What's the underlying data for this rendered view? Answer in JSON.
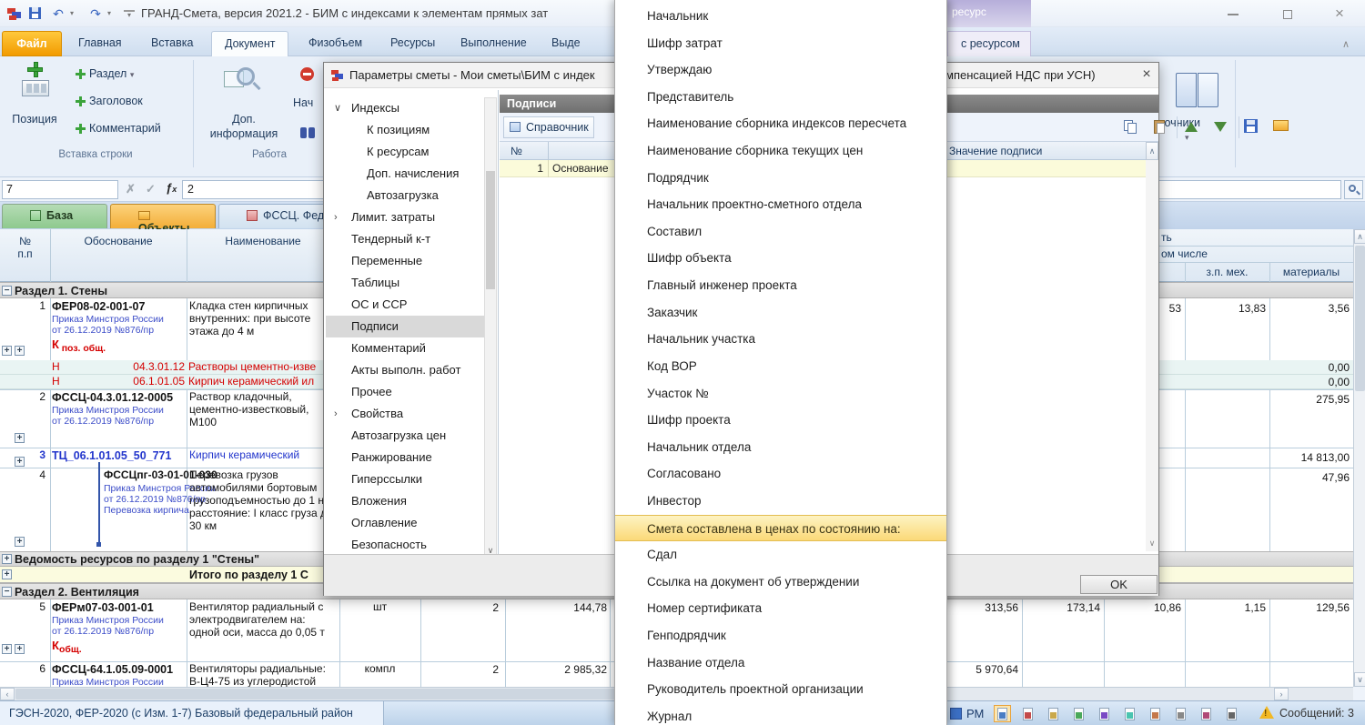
{
  "titlebar": {
    "title": "ГРАНД-Смета, версия 2021.2 - БИМ с индексами к элементам прямых зат"
  },
  "ribbon_tabs": {
    "file": "Файл",
    "items": [
      "Главная",
      "Вставка",
      "Документ",
      "Физобъем",
      "Ресурсы",
      "Выполнение",
      "Выде"
    ],
    "active": "Документ",
    "contextual_group": "ресурс",
    "contextual_tab": "с ресурсом"
  },
  "ribbon": {
    "position_btn": "Позиция",
    "razdel_btn": "Раздел",
    "zagolovok_btn": "Заголовок",
    "kommentariy_btn": "Комментарий",
    "group_insert": "Вставка строки",
    "dopinfo_line1": "Доп.",
    "dopinfo_line2": "информация",
    "nach_partial": "Нач",
    "group_work": "Работа",
    "spravochniki_partial": "авочники"
  },
  "formula_bar": {
    "cell_ref": "7",
    "value": "2"
  },
  "doc_tabs": {
    "baza": "База",
    "obekty": "Объекты",
    "fssc": "ФССЦ. Федеральны"
  },
  "grid": {
    "headers": {
      "num1": "№",
      "num2": "п.п",
      "justification": "Обоснование",
      "name": "Наименование",
      "cost_tail": "ть",
      "incl_tail": "ом числе",
      "zp_meh": "з.п. мех.",
      "materials": "материалы"
    },
    "section1": "Раздел 1. Стены",
    "r1": {
      "num": "1",
      "code": "ФЕР08-02-001-07",
      "order1": "Приказ Минстроя России",
      "order2": "от 26.12.2019 №876/пр",
      "k": "К",
      "k_sub": "поз. общ.",
      "name": "Кладка стен кирпичных внутренних: при высоте этажа до 4 м",
      "c3": "53",
      "zp_meh": "13,83",
      "materials": "3,56"
    },
    "h1": {
      "flag": "Н",
      "code": "04.3.01.12",
      "name": "Растворы цементно-изве",
      "materials": "0,00"
    },
    "h2": {
      "flag": "Н",
      "code": "06.1.01.05",
      "name": "Кирпич керамический ил",
      "materials": "0,00"
    },
    "r2": {
      "num": "2",
      "code": "ФССЦ-04.3.01.12-0005",
      "order1": "Приказ Минстроя России",
      "order2": "от 26.12.2019 №876/пр",
      "name": "Раствор кладочный, цементно-известковый, М100",
      "materials": "275,95"
    },
    "r3": {
      "num": "3",
      "code": "ТЦ_06.1.01.05_50_771",
      "name": "Кирпич керамический",
      "materials": "14 813,00"
    },
    "r4": {
      "num": "4",
      "code": "ФССЦпг-03-01-01-030",
      "order1": "Приказ Минстроя России",
      "order2": "от 26.12.2019 №876/пр",
      "order3": "Перевозка кирпича",
      "name": "Перевозка грузов автомобилями бортовым грузоподъемностью до 1 на расстояние: I класс груза до 30 км",
      "materials": "47,96"
    },
    "vedomost": "Ведомость ресурсов по разделу 1 \"Стены\"",
    "itogo": "Итого по разделу 1 С",
    "section2": "Раздел 2. Вентиляция",
    "r5": {
      "num": "5",
      "code": "ФЕРм07-03-001-01",
      "order1": "Приказ Минстроя России",
      "order2": "от 26.12.2019 №876/пр",
      "k": "К",
      "k_sub": "общ.",
      "name": "Вентилятор радиальный с электродвигателем на: одной оси, масса до 0,05 т",
      "unit": "шт",
      "qty": "2",
      "price": "144,78",
      "v1": "313,56",
      "v2": "173,14",
      "v3": "10,86",
      "v4": "1,15",
      "v5": "129,56"
    },
    "r6": {
      "num": "6",
      "code": "ФССЦ-64.1.05.09-0001",
      "order1": "Приказ Минстроя России",
      "name": "Вентиляторы радиальные: В-Ц4-75 из углеродистой",
      "unit": "компл",
      "qty": "2",
      "price": "2 985,32",
      "v1": "5 970,64"
    }
  },
  "dialog": {
    "title_left": "Параметры сметы - Мои сметы\\БИМ с индек",
    "title_right": "мпенсацией НДС при УСН)",
    "panel_title": "Подписи",
    "reference_btn": "Справочник",
    "col_num": "№",
    "col_value": "Значение подписи",
    "row1": {
      "num": "1",
      "name": "Основание"
    },
    "ok_btn": "OK",
    "nav": {
      "items": [
        {
          "label": "Индексы",
          "level": 0,
          "arrow": "expanded"
        },
        {
          "label": "К позициям",
          "level": 1
        },
        {
          "label": "К ресурсам",
          "level": 1
        },
        {
          "label": "Доп. начисления",
          "level": 1
        },
        {
          "label": "Автозагрузка",
          "level": 1
        },
        {
          "label": "Лимит. затраты",
          "level": 0,
          "arrow": "collapsed"
        },
        {
          "label": "Тендерный к-т",
          "level": 0
        },
        {
          "label": "Переменные",
          "level": 0
        },
        {
          "label": "Таблицы",
          "level": 0
        },
        {
          "label": "ОС и ССР",
          "level": 0
        },
        {
          "label": "Подписи",
          "level": 0,
          "selected": true
        },
        {
          "label": "Комментарий",
          "level": 0
        },
        {
          "label": "Акты выполн. работ",
          "level": 0
        },
        {
          "label": "Прочее",
          "level": 0
        },
        {
          "label": "Свойства",
          "level": 0,
          "arrow": "collapsed"
        },
        {
          "label": "Автозагрузка цен",
          "level": 0
        },
        {
          "label": "Ранжирование",
          "level": 0
        },
        {
          "label": "Гиперссылки",
          "level": 0
        },
        {
          "label": "Вложения",
          "level": 0
        },
        {
          "label": "Оглавление",
          "level": 0
        },
        {
          "label": "Безопасность",
          "level": 0
        }
      ]
    }
  },
  "menu": {
    "items": [
      {
        "label": "Начальник"
      },
      {
        "label": "Шифр затрат"
      },
      {
        "label": "Утверждаю"
      },
      {
        "label": "Представитель"
      },
      {
        "label": "Наименование сборника индексов пересчета"
      },
      {
        "label": "Наименование сборника текущих цен"
      },
      {
        "label": "Подрядчик"
      },
      {
        "label": "Начальник проектно-сметного отдела"
      },
      {
        "label": "Составил"
      },
      {
        "label": "Шифр объекта"
      },
      {
        "label": "Главный инженер проекта"
      },
      {
        "label": "Заказчик"
      },
      {
        "label": "Начальник участка"
      },
      {
        "label": "Код ВОР"
      },
      {
        "label": "Участок №"
      },
      {
        "label": "Шифр проекта"
      },
      {
        "label": "Начальник отдела"
      },
      {
        "label": "Согласовано"
      },
      {
        "label": "Инвестор"
      },
      {
        "label": "Смета составлена в ценах по состоянию на:",
        "highlighted": true
      },
      {
        "label": "Сдал"
      },
      {
        "label": "Ссылка на документ об утверждении"
      },
      {
        "label": "Номер сертификата"
      },
      {
        "label": "Генподрядчик"
      },
      {
        "label": "Название отдела"
      },
      {
        "label": "Руководитель проектной организации"
      },
      {
        "label": "Журнал"
      }
    ]
  },
  "status_bar": {
    "region": "ГЭСН-2020, ФЕР-2020 (с Изм. 1-7) Базовый федеральный район",
    "pm": "РМ",
    "messages": "Сообщений: 3"
  },
  "colors": {
    "accent_orange": "#f0a330",
    "menu_highlight": "#fbdc7d",
    "red_text": "#d40000",
    "blue_text": "#2336cc",
    "tab_green": "#8ec98e"
  }
}
